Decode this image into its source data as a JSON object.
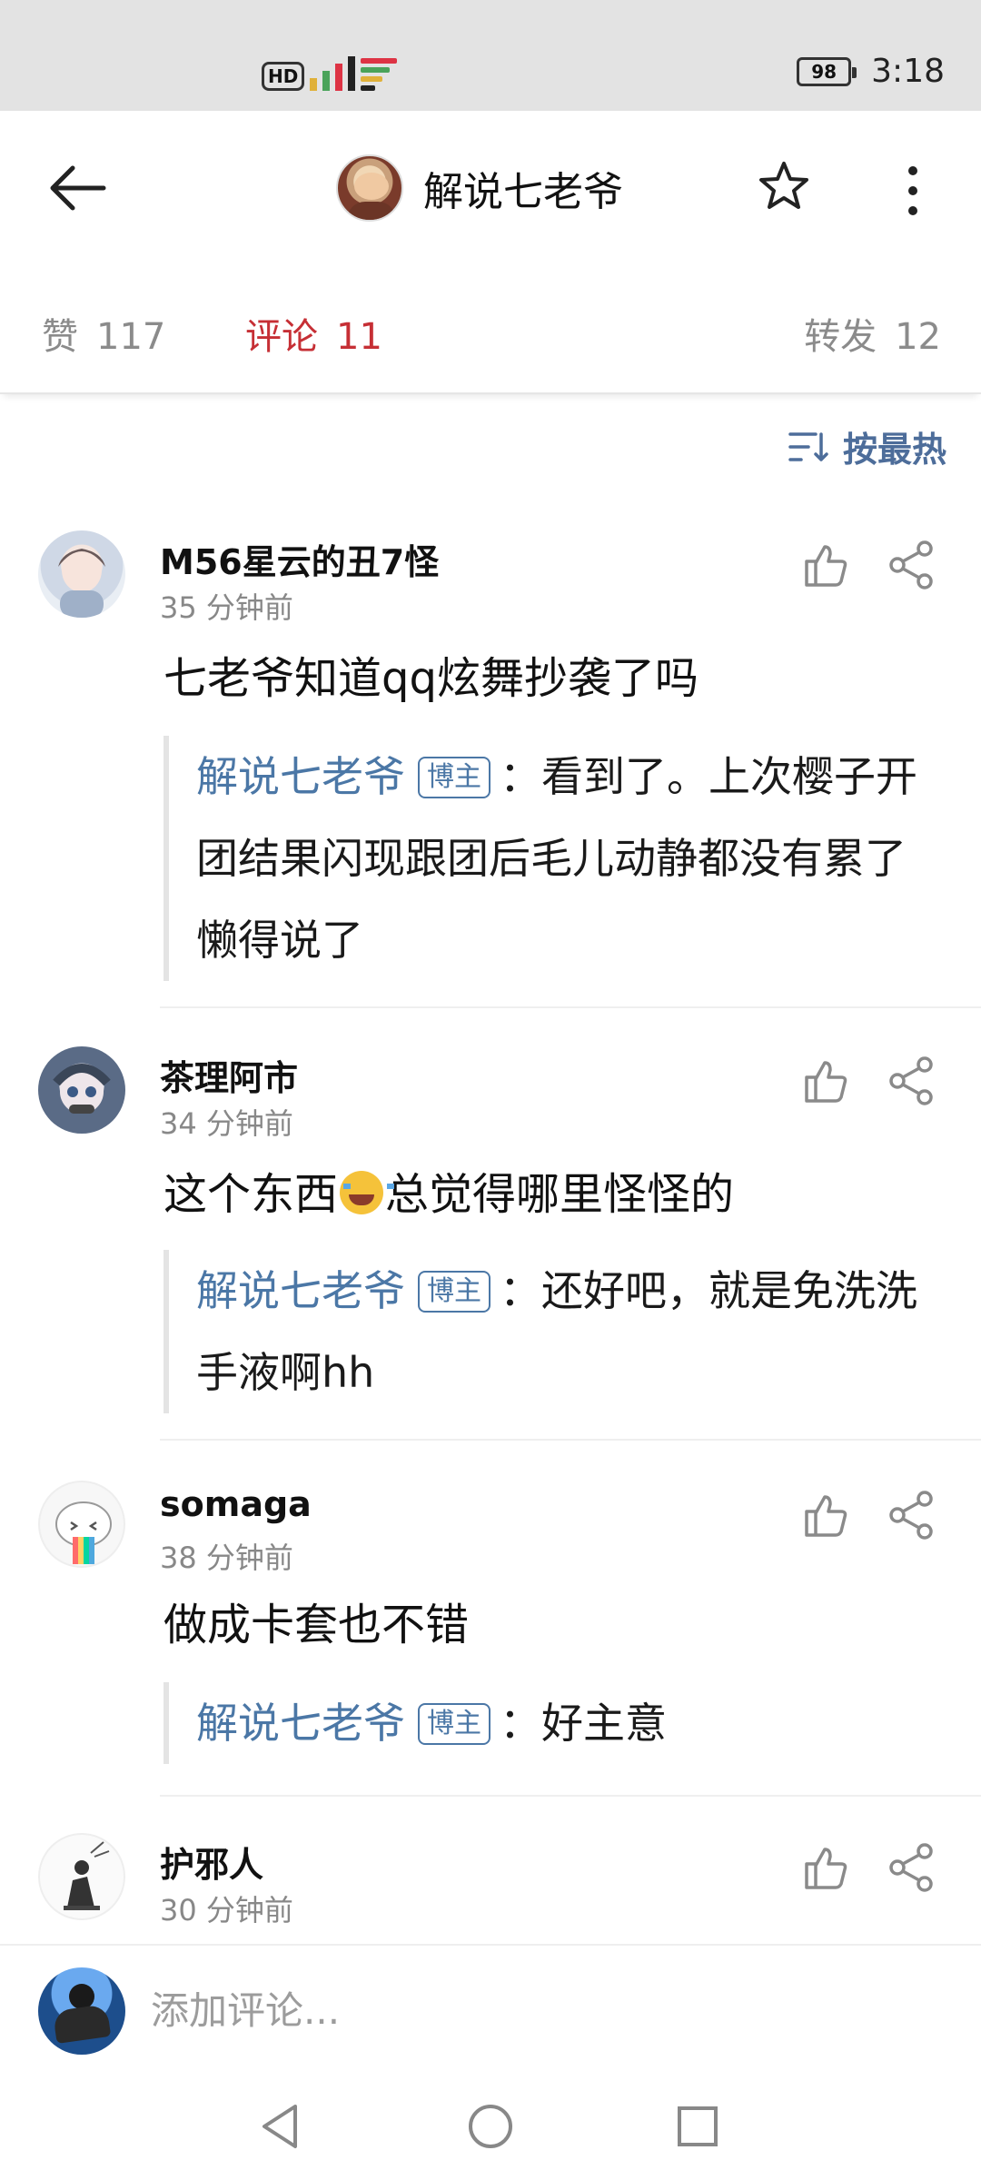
{
  "status_bar": {
    "hd_label": "HD",
    "battery": "98",
    "time": "3:18"
  },
  "header": {
    "title": "解说七老爷",
    "back_icon": "arrow-left-icon",
    "star_icon": "star-outline-icon",
    "more_icon": "more-vertical-icon"
  },
  "tabs": [
    {
      "label": "赞",
      "count": "117",
      "active": false
    },
    {
      "label": "评论",
      "count": "11",
      "active": true
    },
    {
      "label": "转发",
      "count": "12",
      "active": false
    }
  ],
  "sort": {
    "label": "按最热",
    "icon": "sort-icon"
  },
  "comments": [
    {
      "user": "M56星云的丑7怪",
      "time": "35 分钟前",
      "text": "七老爷知道qq炫舞抄袭了吗",
      "reply": {
        "author": "解说七老爷",
        "badge": "博主",
        "text": "：看到了。上次樱子开团结果闪现跟团后毛儿动静都没有累了懒得说了"
      }
    },
    {
      "user": "茶理阿市",
      "time": "34 分钟前",
      "text_before": "这个东西",
      "emoji": "laugh-cry-emoji",
      "text_after": "总觉得哪里怪怪的",
      "reply": {
        "author": "解说七老爷",
        "badge": "博主",
        "text": "：还好吧，就是免洗洗手液啊hh"
      }
    },
    {
      "user": "somaga",
      "time": "38 分钟前",
      "text": "做成卡套也不错",
      "reply": {
        "author": "解说七老爷",
        "badge": "博主",
        "text": "：好主意"
      }
    },
    {
      "user": "护邪人",
      "time": "30 分钟前"
    }
  ],
  "input": {
    "placeholder": "添加评论..."
  },
  "colors": {
    "accent_red": "#c62f35",
    "link_blue": "#4b77a6",
    "sort_blue": "#4d6d9a"
  }
}
